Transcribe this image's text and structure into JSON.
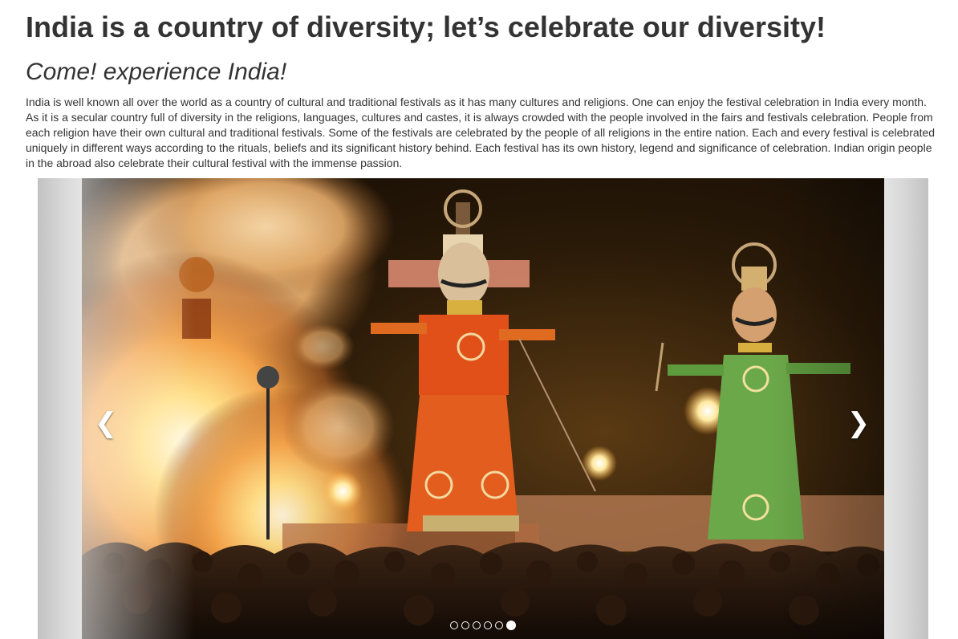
{
  "header": {
    "title": "India is a country of diversity; let’s celebrate our diversity!",
    "subtitle": "Come! experience India!"
  },
  "intro": {
    "paragraph": "India is well known all over the world as a country of cultural and traditional festivals as it has many cultures and religions. One can enjoy the festival celebration in India every month. As it is a secular country full of diversity in the religions, languages, cultures and castes, it is always crowded with the people involved in the fairs and festivals celebration. People from each religion have their own cultural and traditional festivals. Some of the festivals are celebrated by the people of all religions in the entire nation. Each and every festival is celebrated uniquely in different ways according to the rituals, beliefs and its significant history behind. Each festival has its own history, legend and significance of celebration. Indian origin people in the abroad also celebrate their cultural festival with the immense passion."
  },
  "carousel": {
    "prev_icon": "chevron-left-icon",
    "next_icon": "chevron-right-icon",
    "prev_glyph": "❮",
    "next_glyph": "❯",
    "slide_count": 6,
    "active_index": 5
  }
}
